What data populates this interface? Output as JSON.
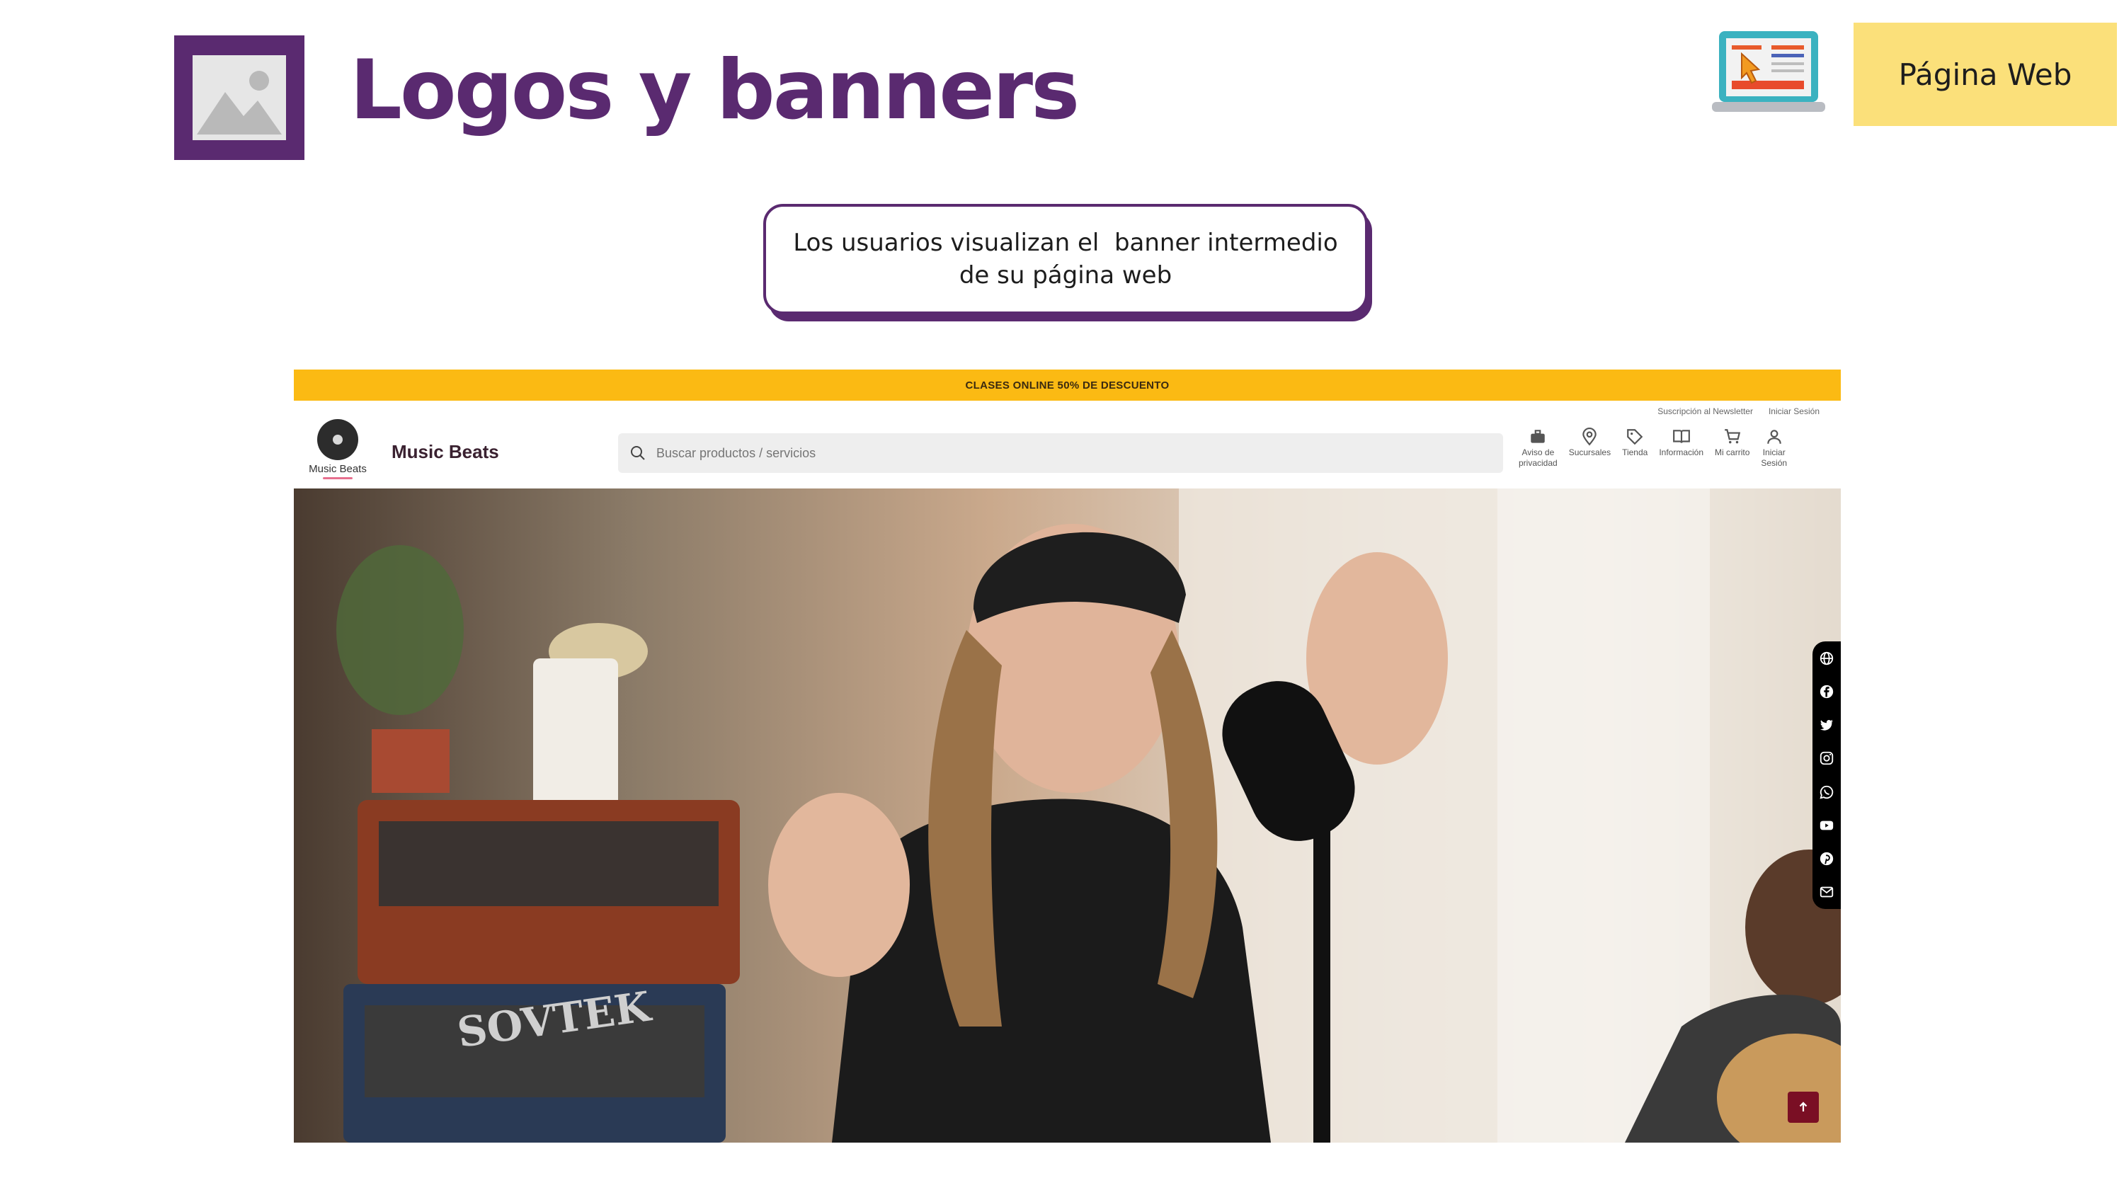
{
  "slide": {
    "title": "Logos y banners",
    "tag": "Página Web",
    "callout_line1": "Los usuarios visualizan el  banner intermedio",
    "callout_line2": "de su página web"
  },
  "site": {
    "promo": "CLASES ONLINE 50% DE DESCUENTO",
    "toplinks": [
      "Suscripción al Newsletter",
      "Iniciar Sesión"
    ],
    "logo_text": "Music Beats",
    "brand_name": "Music Beats",
    "search_placeholder": "Buscar productos / servicios",
    "nav": [
      {
        "label": "Aviso de\nprivacidad",
        "icon": "briefcase-icon"
      },
      {
        "label": "Sucursales",
        "icon": "map-pin-icon"
      },
      {
        "label": "Tienda",
        "icon": "tag-icon"
      },
      {
        "label": "Información",
        "icon": "book-icon"
      },
      {
        "label": "Mi carrito",
        "icon": "cart-icon"
      },
      {
        "label": "Iniciar\nSesión",
        "icon": "user-icon"
      }
    ],
    "social_icons": [
      "globe-icon",
      "facebook-icon",
      "twitter-icon",
      "instagram-icon",
      "whatsapp-icon",
      "youtube-icon",
      "pinterest-icon",
      "email-icon"
    ],
    "hero_text": "SOVTEK"
  },
  "colors": {
    "brand_purple": "#5a2a70",
    "tag_yellow": "#fbe07a",
    "promo_yellow": "#fbba13",
    "scroll_top": "#7a0f24"
  }
}
